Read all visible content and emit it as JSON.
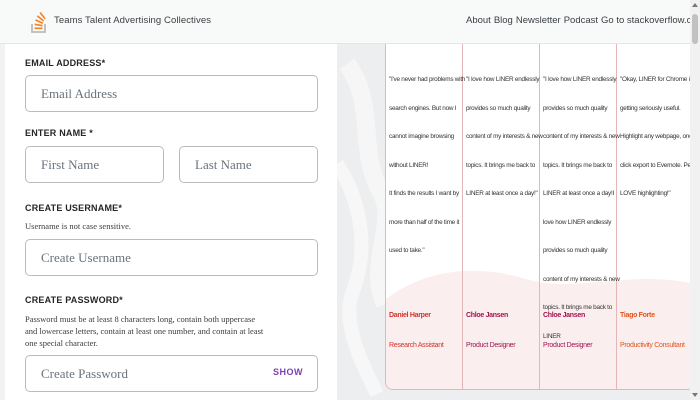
{
  "header": {
    "brand": "Teams Talent Advertising Collectives",
    "nav": [
      "About",
      "Blog",
      "Newsletter",
      "Podcast",
      "Go to stackoverflow.com"
    ]
  },
  "form": {
    "email": {
      "label": "EMAIL ADDRESS*",
      "placeholder": "Email Address"
    },
    "name": {
      "label": "ENTER NAME *",
      "first_placeholder": "First Name",
      "last_placeholder": "Last Name"
    },
    "username": {
      "label": "CREATE USERNAME*",
      "note": "Username is not case sensitive.",
      "placeholder": "Create Username"
    },
    "password": {
      "label": "CREATE PASSWORD*",
      "note_lines": [
        "Password must be at least 8 characters long, contain both uppercase",
        "and lowercase letters, contain at least one number, and contain at least",
        "one special character."
      ],
      "placeholder": "Create Password",
      "show_label": "SHOW"
    }
  },
  "testimonials": [
    {
      "quote": "\"I've never had problems with\nsearch engines. But now I\ncannot imagine browsing\nwithout LINER!\nIt finds the results I want by\nmore than half of the time it\nused to take.\"",
      "name": "Daniel Harper",
      "role": "Research Assistant",
      "name_color": "#d0342c",
      "role_color": "#d0342c"
    },
    {
      "quote": "\"I love how LINER endlessly\nprovides so much quality\ncontent of my interests & new\ntopics. It brings me back to\nLINER at least once a day!\"",
      "name": "Chloe Jansen",
      "role": "Product Designer",
      "name_color": "#a0154f",
      "role_color": "#a0154f"
    },
    {
      "quote": "\"I love how LINER endlessly\nprovides so much quality\ncontent of my interests & new\ntopics. It brings me back to\nLINER at least once a day!I\nlove how LINER endlessly\nprovides so much quality\ncontent of my interests & new\ntopics. It brings me back to\nLINER",
      "name": "Chloe Jansen",
      "role": "Product Designer",
      "name_color": "#a0154f",
      "role_color": "#a0154f"
    },
    {
      "quote": "\"Okay, LINER for Chrome is\ngetting seriously useful.\nHighlight any webpage, one-\nclick export to Evernote. People\nLOVE highlighting!\"",
      "name": "Tiago Forte",
      "role": "Productivity Consultant",
      "name_color": "#e4521b",
      "role_color": "#e4521b"
    }
  ],
  "colors": {
    "accent": "#7b3fb0",
    "logo_orange": "#f48024",
    "card_border": "#e4b6b6",
    "wave": "#fbeeee"
  }
}
